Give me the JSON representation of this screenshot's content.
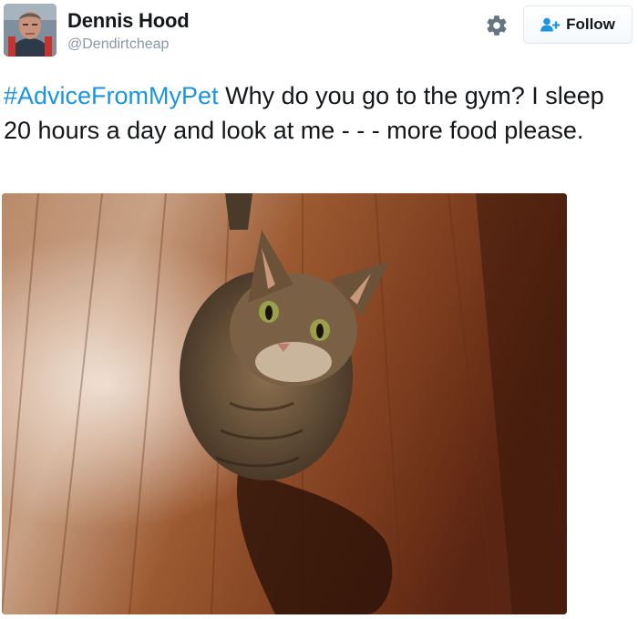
{
  "user": {
    "name": "Dennis Hood",
    "handle": "@Dendirtcheap"
  },
  "actions": {
    "settings_icon": "gear-icon",
    "follow_label": "Follow",
    "follow_icon": "follow-user-icon"
  },
  "tweet": {
    "hashtag": "#AdviceFromMyPet",
    "text": " Why do you go to the gym? I sleep 20 hours a day and look at me - - - more food please."
  },
  "media": {
    "type": "photo",
    "subject": "cat"
  },
  "colors": {
    "accent": "#1b95e0",
    "text": "#14171a",
    "secondary_text": "#8899a6",
    "border": "#e1e8ed"
  }
}
